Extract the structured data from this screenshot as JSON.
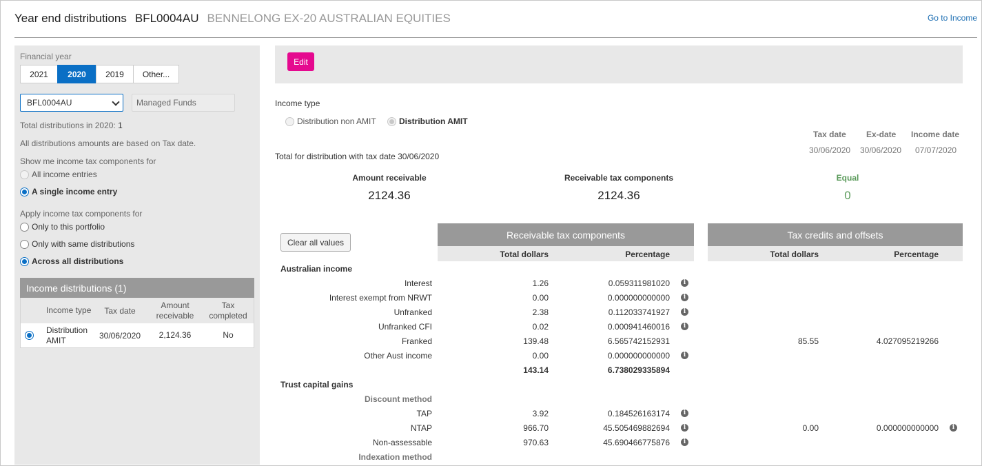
{
  "header": {
    "title": "Year end distributions",
    "code": "BFL0004AU",
    "name": "BENNELONG EX-20 AUSTRALIAN EQUITIES",
    "goto_link": "Go to Income"
  },
  "left": {
    "financial_year_label": "Financial year",
    "years": [
      "2021",
      "2020",
      "2019",
      "Other..."
    ],
    "selected_year": "2020",
    "security_select": "BFL0004AU",
    "fund_type": "Managed Funds",
    "total_label": "Total distributions in 2020:",
    "total_count": "1",
    "note": "All distributions amounts are based on Tax date.",
    "show_label": "Show me income tax components for",
    "show_options": [
      "All income entries",
      "A single income entry"
    ],
    "apply_label": "Apply income tax components for",
    "apply_options": [
      "Only to this portfolio",
      "Only with same distributions",
      "Across all distributions"
    ],
    "income_distributions": {
      "title": "Income distributions (1)",
      "columns": [
        "Income type",
        "Tax date",
        "Amount receivable",
        "Tax completed"
      ],
      "rows": [
        {
          "income_type": "Distribution AMIT",
          "tax_date": "30/06/2020",
          "amount": "2,124.36",
          "tax_completed": "No"
        }
      ]
    }
  },
  "toolbar": {
    "edit_label": "Edit"
  },
  "main": {
    "income_type_label": "Income type",
    "income_type_options": [
      "Distribution non AMIT",
      "Distribution AMIT"
    ],
    "dates": {
      "headers": [
        "Tax date",
        "Ex-date",
        "Income date"
      ],
      "values": [
        "30/06/2020",
        "30/06/2020",
        "07/07/2020"
      ]
    },
    "total_heading": "Total for distribution with tax date 30/06/2020",
    "summary": {
      "amount_receivable_label": "Amount receivable",
      "amount_receivable_value": "2124.36",
      "receivable_tax_label": "Receivable tax components",
      "receivable_tax_value": "2124.36",
      "equal_label": "Equal",
      "equal_value": "0"
    },
    "clear_button": "Clear all values",
    "group_receivable": "Receivable tax components",
    "group_credits": "Tax credits and offsets",
    "col_total": "Total dollars",
    "col_pct": "Percentage",
    "sections": {
      "australian_income": "Australian income",
      "trust_capital_gains": "Trust capital gains",
      "discount_method": "Discount method",
      "indexation_method": "Indexation method"
    },
    "rows": [
      {
        "label": "Interest",
        "total": "1.26",
        "pct": "0.059311981020",
        "info": true,
        "credit_total": "",
        "credit_pct": ""
      },
      {
        "label": "Interest exempt from NRWT",
        "total": "0.00",
        "pct": "0.000000000000",
        "info": true,
        "credit_total": "",
        "credit_pct": ""
      },
      {
        "label": "Unfranked",
        "total": "2.38",
        "pct": "0.112033741927",
        "info": true,
        "credit_total": "",
        "credit_pct": ""
      },
      {
        "label": "Unfranked CFI",
        "total": "0.02",
        "pct": "0.000941460016",
        "info": true,
        "credit_total": "",
        "credit_pct": ""
      },
      {
        "label": "Franked",
        "total": "139.48",
        "pct": "6.565742152931",
        "info": false,
        "credit_total": "85.55",
        "credit_pct": "4.027095219266"
      },
      {
        "label": "Other Aust income",
        "total": "0.00",
        "pct": "0.000000000000",
        "info": true,
        "credit_total": "",
        "credit_pct": ""
      }
    ],
    "aus_subtotal": {
      "total": "143.14",
      "pct": "6.738029335894"
    },
    "cg_rows": [
      {
        "label": "TAP",
        "total": "3.92",
        "pct": "0.184526163174",
        "info": true,
        "credit_total": "",
        "credit_pct": ""
      },
      {
        "label": "NTAP",
        "total": "966.70",
        "pct": "45.505469882694",
        "info": true,
        "credit_total": "0.00",
        "credit_pct": "0.000000000000"
      },
      {
        "label": "Non-assessable",
        "total": "970.63",
        "pct": "45.690466775876",
        "info": true,
        "credit_total": "",
        "credit_pct": ""
      }
    ]
  }
}
